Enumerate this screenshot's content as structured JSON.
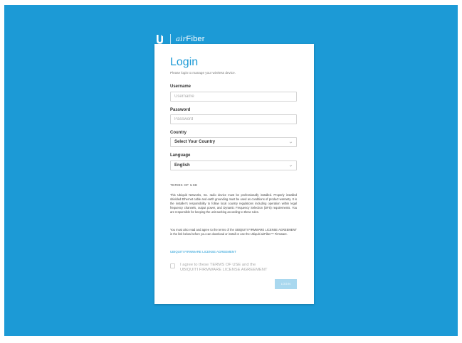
{
  "brand": {
    "logo_icon": "ubiquiti-u-icon",
    "product_prefix": "air",
    "product_name": "Fiber"
  },
  "login": {
    "title": "Login",
    "subtitle": "Please login to manage your wireless device.",
    "username_label": "Username",
    "username_placeholder": "Username",
    "username_value": "",
    "password_label": "Password",
    "password_placeholder": "Password",
    "password_value": "",
    "country_label": "Country",
    "country_selected": "Select Your Country",
    "language_label": "Language",
    "language_selected": "English"
  },
  "terms": {
    "heading": "TERMS OF USE",
    "paragraph1": "This Ubiquiti Networks, Inc. radio device must be professionally installed. Properly installed shielded Ethernet cable and earth grounding must be used as conditions of product warranty. It is the installer's responsibility to follow local country regulations including operation within legal frequency channels, output power, and Dynamic Frequency Selection (DFS) requirements. You are responsible for keeping the unit working according to these rules.",
    "paragraph2": "You must also read and agree to the terms of the UBIQUITI FIRMWARE LICENSE AGREEMENT in the link below before you can download or install or use the Ubiquiti airFiber™ Firmware.",
    "license_link": "UBIQUITI FIRMWARE LICENSE AGREEMENT",
    "agree_line1": "I agree to these TERMS OF USE and the",
    "agree_line2": "UBIQUITI FIRMWARE LICENSE AGREEMENT",
    "agree_checked": false
  },
  "actions": {
    "login_label": "LOGIN"
  },
  "colors": {
    "background": "#1c9ad6",
    "accent": "#1c9ad6",
    "button_disabled": "#a9d8ef"
  }
}
